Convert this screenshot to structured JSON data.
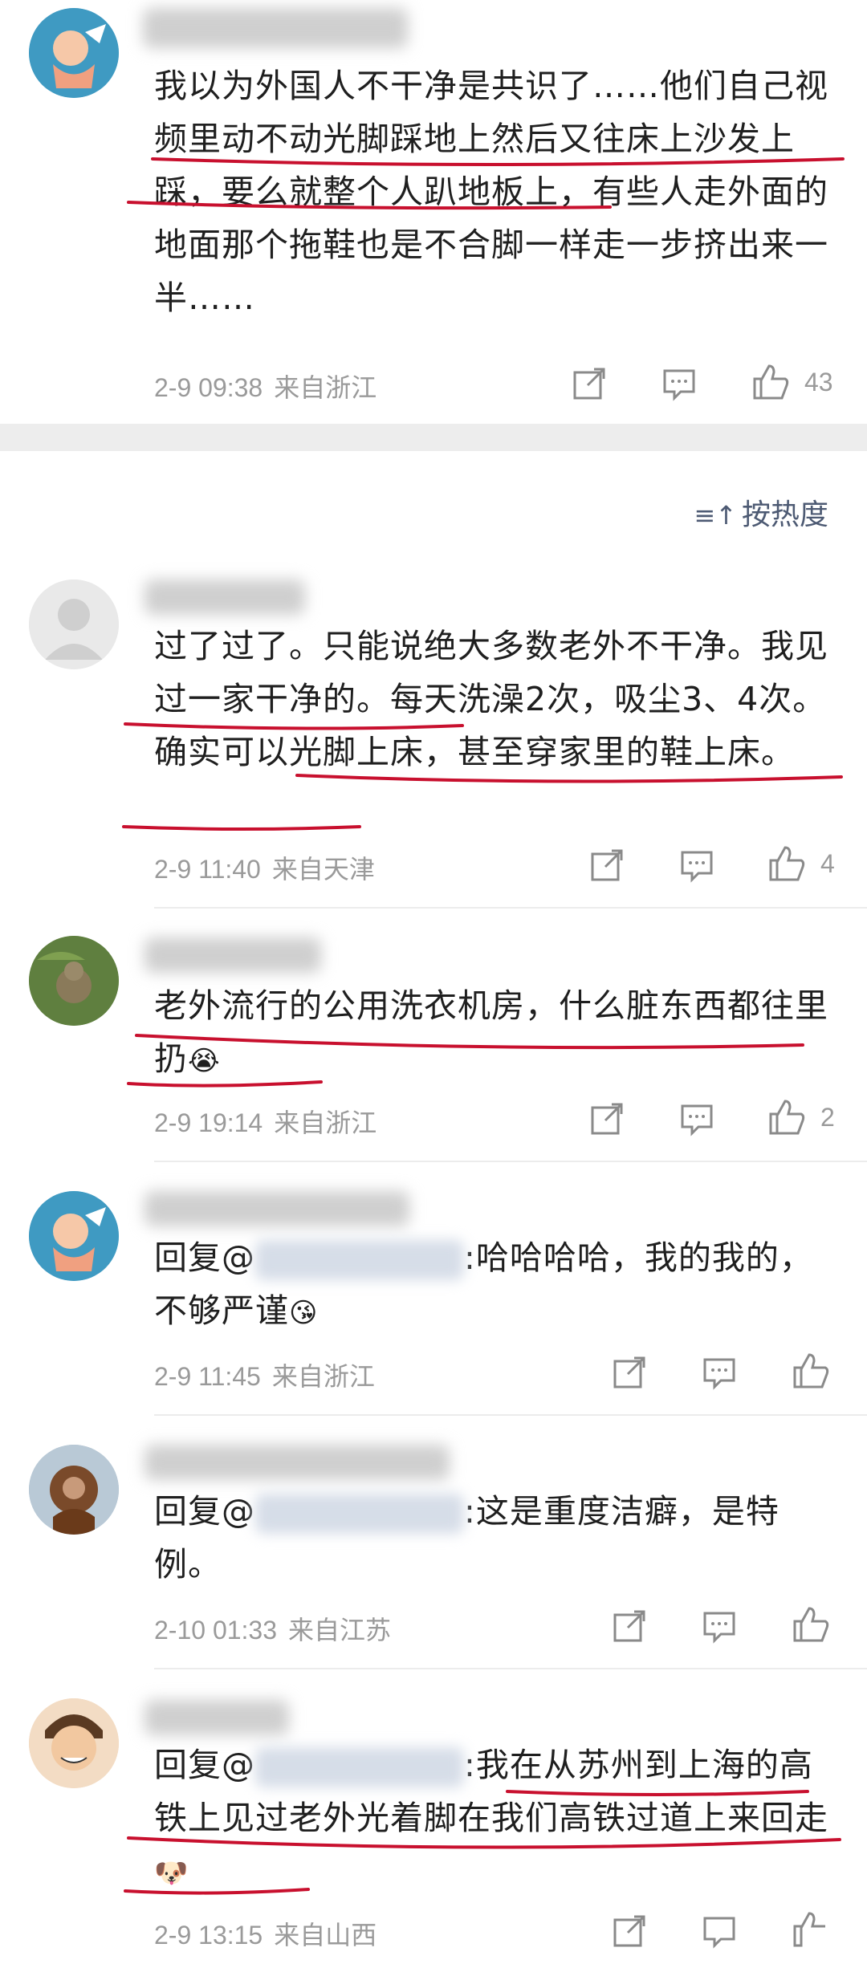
{
  "comments": [
    {
      "text": "我以为外国人不干净是共识了……他们自己视频里动不动光脚踩地上然后又往床上沙发上踩，要么就整个人趴地板上，有些人走外面的地面那个拖鞋也是不合脚一样走一步挤出来一半……",
      "time": "2-9 09:38",
      "location": "来自浙江",
      "likes": "43"
    },
    {
      "text": "过了过了。只能说绝大多数老外不干净。我见过一家干净的。每天洗澡2次，吸尘3、4次。确实可以光脚上床，甚至穿家里的鞋上床。",
      "time": "2-9 11:40",
      "location": "来自天津",
      "likes": "4"
    },
    {
      "text": "老外流行的公用洗衣机房，什么脏东西都往里扔",
      "emoji": "😭",
      "time": "2-9 19:14",
      "location": "来自浙江",
      "likes": "2"
    },
    {
      "prefix": "回复@",
      "text_after": ":哈哈哈哈，我的我的，不够严谨",
      "emoji": "😘",
      "time": "2-9 11:45",
      "location": "来自浙江"
    },
    {
      "prefix": "回复@",
      "text_after": ":这是重度洁癖，是特例。",
      "time": "2-10 01:33",
      "location": "来自江苏"
    },
    {
      "prefix": "回复@",
      "text_after": ":我在从苏州到上海的高铁上见过老外光着脚在我们高铁过道上来回走",
      "emoji": "🐶",
      "time": "2-9 13:15",
      "location": "来自山西"
    }
  ],
  "sort_label": "按热度",
  "icons": {
    "share": "share-icon",
    "comment": "comment-icon",
    "like": "thumbs-up-icon",
    "sort": "sort-icon"
  },
  "colors": {
    "underline": "#c8102e",
    "meta": "#9a9a9a",
    "sort": "#4d5a73"
  }
}
